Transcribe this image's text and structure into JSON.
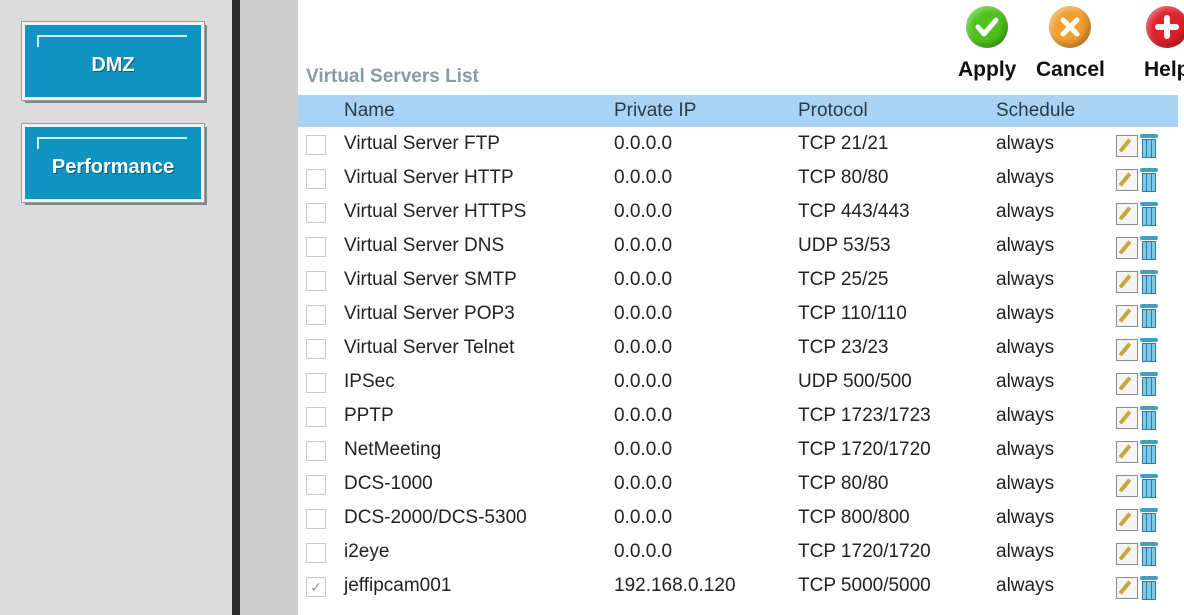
{
  "sidebar": {
    "buttons": [
      {
        "label": "DMZ"
      },
      {
        "label": "Performance"
      }
    ]
  },
  "actions": {
    "apply_label": "Apply",
    "cancel_label": "Cancel",
    "help_label": "Help"
  },
  "list": {
    "title": "Virtual Servers List",
    "columns": [
      "Name",
      "Private IP",
      "Protocol",
      "Schedule"
    ],
    "rows": [
      {
        "name": "Virtual Server FTP",
        "ip": "0.0.0.0",
        "protocol": "TCP 21/21",
        "schedule": "always",
        "checked": false
      },
      {
        "name": "Virtual Server HTTP",
        "ip": "0.0.0.0",
        "protocol": "TCP 80/80",
        "schedule": "always",
        "checked": false
      },
      {
        "name": "Virtual Server HTTPS",
        "ip": "0.0.0.0",
        "protocol": "TCP 443/443",
        "schedule": "always",
        "checked": false
      },
      {
        "name": "Virtual Server DNS",
        "ip": "0.0.0.0",
        "protocol": "UDP 53/53",
        "schedule": "always",
        "checked": false
      },
      {
        "name": "Virtual Server SMTP",
        "ip": "0.0.0.0",
        "protocol": "TCP 25/25",
        "schedule": "always",
        "checked": false
      },
      {
        "name": "Virtual Server POP3",
        "ip": "0.0.0.0",
        "protocol": "TCP 110/110",
        "schedule": "always",
        "checked": false
      },
      {
        "name": "Virtual Server Telnet",
        "ip": "0.0.0.0",
        "protocol": "TCP 23/23",
        "schedule": "always",
        "checked": false
      },
      {
        "name": "IPSec",
        "ip": "0.0.0.0",
        "protocol": "UDP 500/500",
        "schedule": "always",
        "checked": false
      },
      {
        "name": "PPTP",
        "ip": "0.0.0.0",
        "protocol": "TCP 1723/1723",
        "schedule": "always",
        "checked": false
      },
      {
        "name": "NetMeeting",
        "ip": "0.0.0.0",
        "protocol": "TCP 1720/1720",
        "schedule": "always",
        "checked": false
      },
      {
        "name": "DCS-1000",
        "ip": "0.0.0.0",
        "protocol": "TCP 80/80",
        "schedule": "always",
        "checked": false
      },
      {
        "name": "DCS-2000/DCS-5300",
        "ip": "0.0.0.0",
        "protocol": "TCP 800/800",
        "schedule": "always",
        "checked": false
      },
      {
        "name": "i2eye",
        "ip": "0.0.0.0",
        "protocol": "TCP 1720/1720",
        "schedule": "always",
        "checked": false
      },
      {
        "name": "jeffipcam001",
        "ip": "192.168.0.120",
        "protocol": "TCP 5000/5000",
        "schedule": "always",
        "checked": true
      }
    ]
  },
  "colors": {
    "nav_button": "#0f94c2",
    "header_band": "#a9d3f5",
    "apply": "#4fc21a",
    "cancel": "#f0a030",
    "help": "#e0202a"
  },
  "icons": [
    "apply-check-icon",
    "cancel-x-icon",
    "help-plus-icon",
    "edit-icon",
    "trash-icon"
  ]
}
